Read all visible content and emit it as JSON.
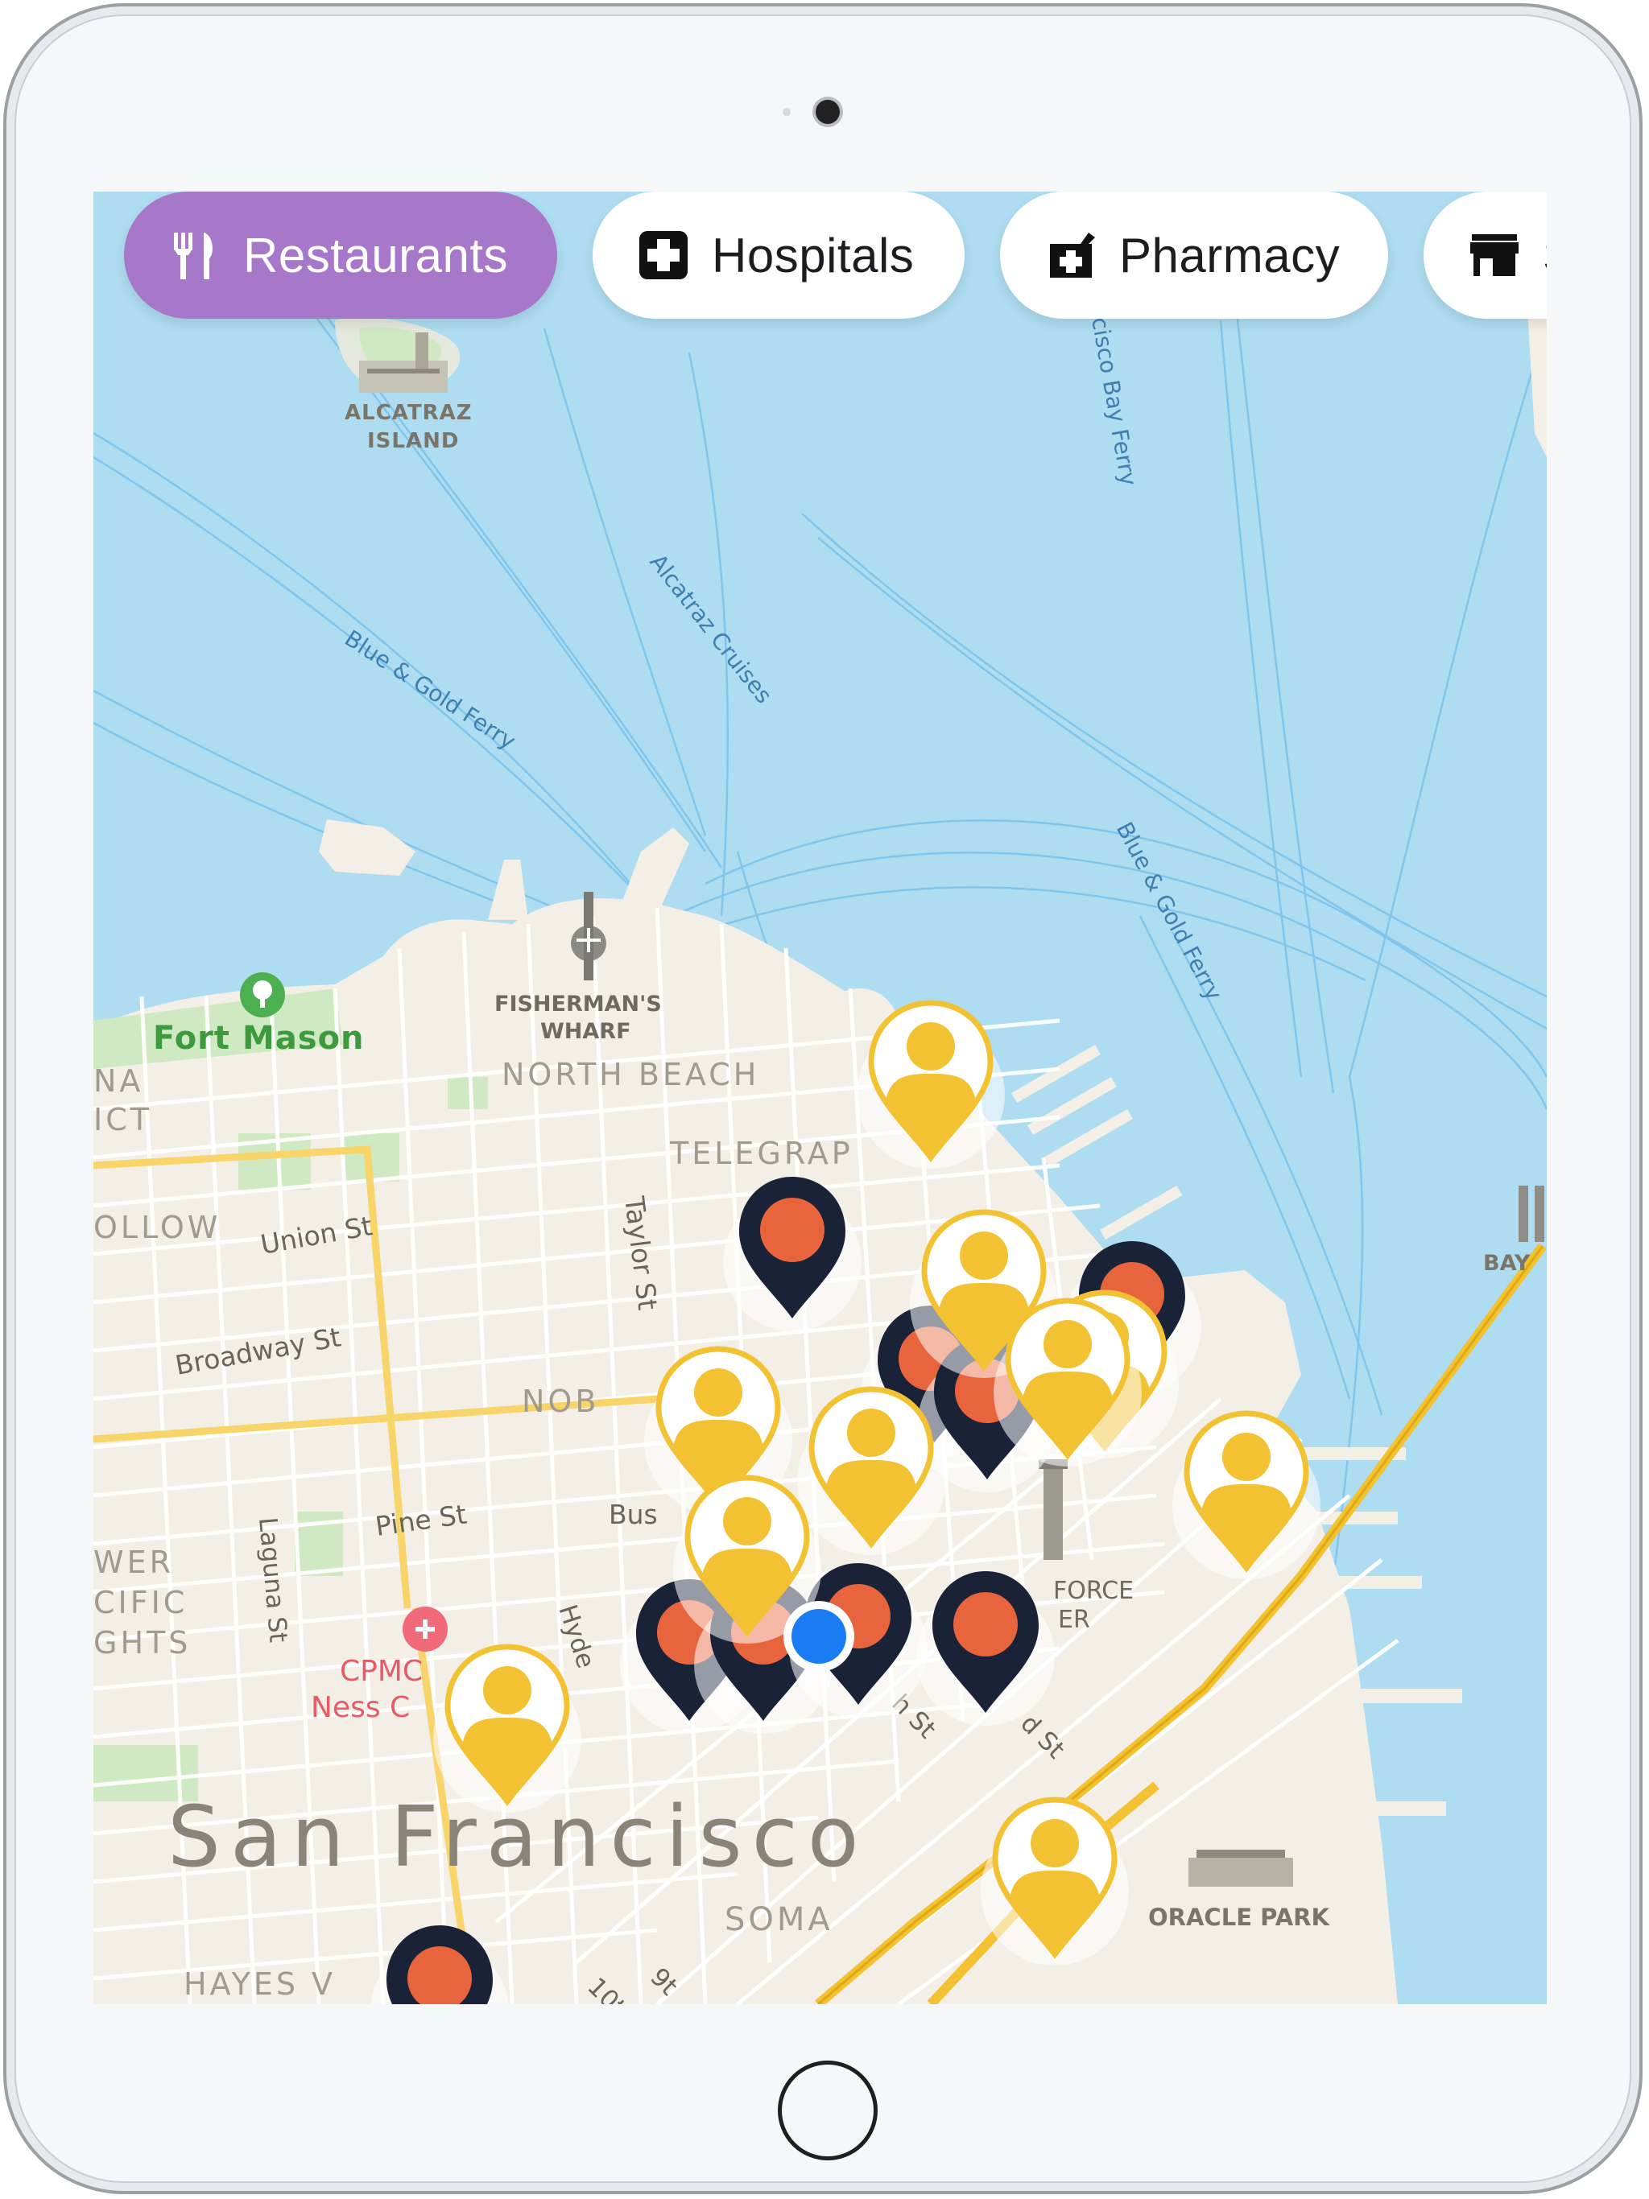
{
  "chips": [
    {
      "label": "Restaurants",
      "icon": "fork-knife-icon",
      "active": true
    },
    {
      "label": "Hospitals",
      "icon": "hospital-cross-icon",
      "active": false
    },
    {
      "label": "Pharmacy",
      "icon": "pharmacy-icon",
      "active": false
    },
    {
      "label": "S",
      "icon": "store-icon",
      "active": false
    }
  ],
  "map_labels": {
    "alcatraz": "ALCATRAZ",
    "island": "ISLAND",
    "ferry_top": "cisco Bay Ferry",
    "alcatraz_cruises": "Alcatraz Cruises",
    "blue_gold_ferry_1": "Blue & Gold Ferry",
    "blue_gold_ferry_2": "Blue & Gold Ferry",
    "fort_mason": "Fort Mason",
    "fishermans": "FISHERMAN'S",
    "wharf": "WHARF",
    "north_beach": "NORTH BEACH",
    "telegraph": "TELEGRAP",
    "na": "NA",
    "ict": "ICT",
    "ollow": "OLLOW",
    "union_st": "Union St",
    "broadway_st": "Broadway St",
    "taylor_st": "Taylor St",
    "nob": "NOB",
    "pine_st": "Pine St",
    "bus": "Bus",
    "laguna_st": "Laguna St",
    "hyde": "Hyde",
    "wer": "WER",
    "cific": "CIFIC",
    "ghts": "GHTS",
    "cpmc": "CPMC",
    "ness": "Ness C",
    "force": "FORCE",
    "er": "ER",
    "h_st": "h St",
    "d_st": "d St",
    "bay": "BAY",
    "san_francisco": "San Francisco",
    "soma": "SOMA",
    "oracle_park": "ORACLE PARK",
    "hayes": "HAYES V",
    "tenth": "10t",
    "ninth": "9t"
  },
  "colors": {
    "water": "#aedcf0",
    "land": "#f3efe6",
    "park": "#cfe9c3",
    "highway": "#f7c94a",
    "chip_active": "#a777c9",
    "pin_yellow": "#f2c233",
    "pin_navy": "#1a2238",
    "pin_orange": "#e8643c",
    "user_location": "#1a7cf5"
  },
  "pins": {
    "person_markers": 10,
    "restaurant_markers": 10
  }
}
